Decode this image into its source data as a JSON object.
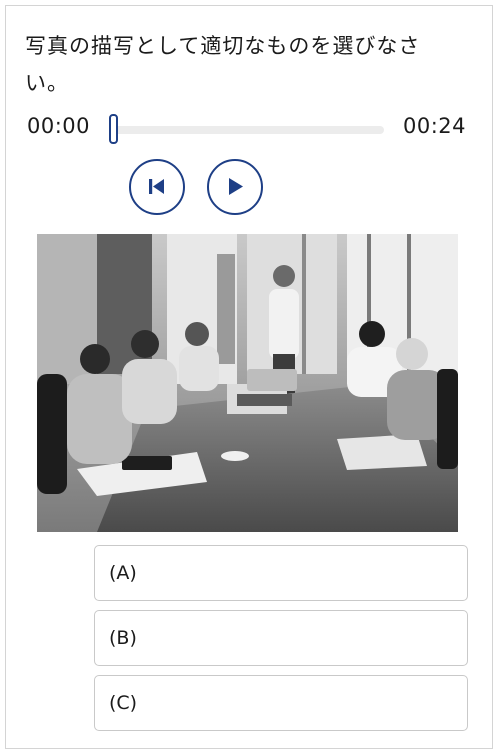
{
  "question": {
    "text": "写真の描写として適切なものを選びなさい。"
  },
  "player": {
    "current_time": "00:00",
    "total_time": "00:24",
    "progress": 0,
    "rewind_icon": "skip-back-icon",
    "play_icon": "play-icon",
    "accent_color": "#1e3f86"
  },
  "photo": {
    "subject": "business-meeting-photo"
  },
  "choices": [
    {
      "label": "(A)"
    },
    {
      "label": "(B)"
    },
    {
      "label": "(C)"
    }
  ]
}
